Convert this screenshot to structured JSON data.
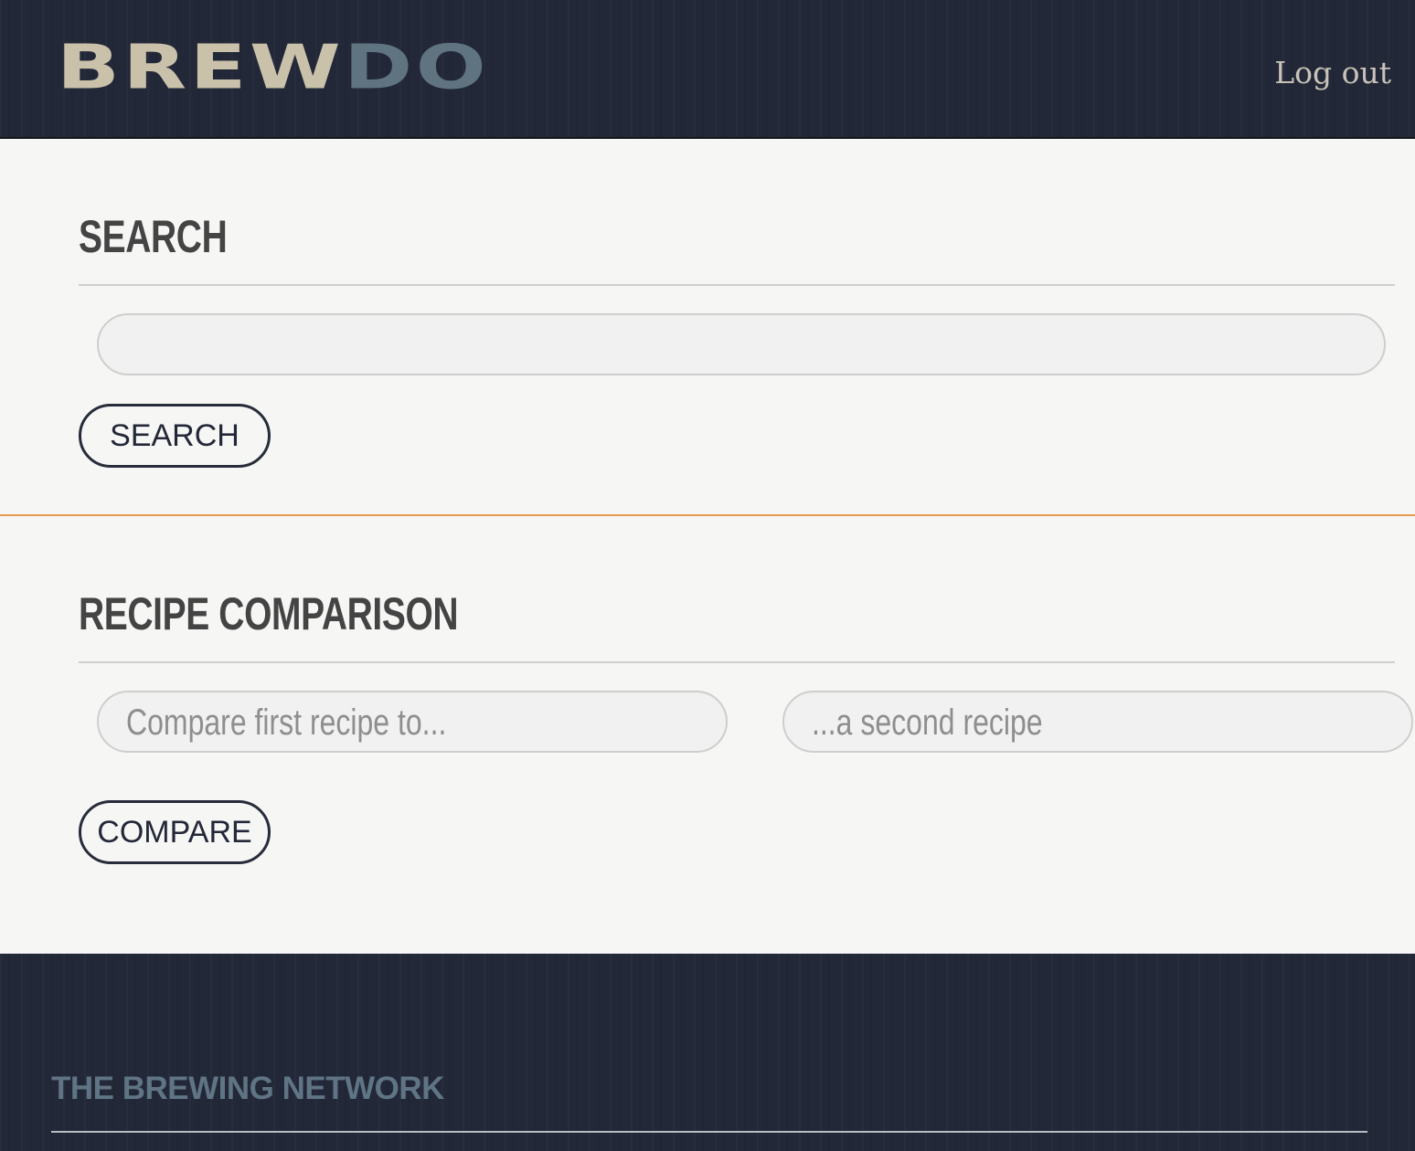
{
  "header": {
    "logo_part1": "BREW",
    "logo_part2": "DO",
    "logout_label": "Log out"
  },
  "search": {
    "heading": "SEARCH",
    "input_value": "",
    "button_label": "SEARCH"
  },
  "comparison": {
    "heading": "RECIPE COMPARISON",
    "first_placeholder": "Compare first recipe to...",
    "second_placeholder": "...a second recipe",
    "button_label": "COMPARE"
  },
  "footer": {
    "title": "THE BREWING NETWORK"
  },
  "colors": {
    "header_bg": "#232838",
    "page_bg": "#f6f6f5",
    "section_divider": "#e69a4e",
    "logo_tan": "#c9c1aa",
    "logo_slate": "#5f7480",
    "footer_title": "#5f7484"
  }
}
